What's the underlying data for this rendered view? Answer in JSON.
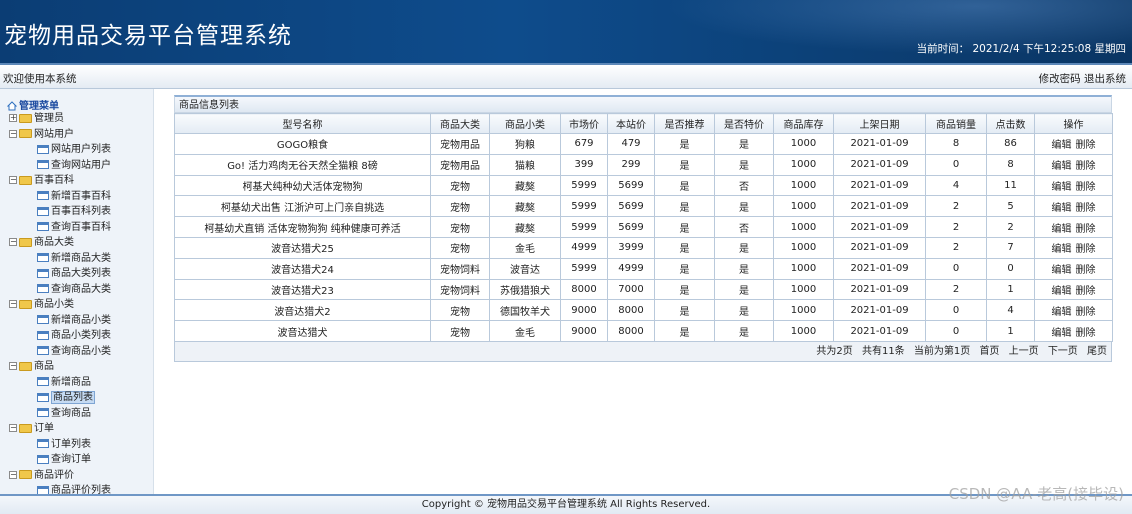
{
  "header": {
    "title": "宠物用品交易平台管理系统",
    "time_label": "当前时间：",
    "time_value": "2021/2/4 下午12:25:08 星期四"
  },
  "topbar": {
    "welcome": "欢迎使用本系统",
    "change_password": "修改密码",
    "logout": "退出系统"
  },
  "sidebar": {
    "root": "管理菜单",
    "groups": [
      {
        "label": "管理员",
        "items": []
      },
      {
        "label": "网站用户",
        "items": [
          "网站用户列表",
          "查询网站用户"
        ]
      },
      {
        "label": "百事百科",
        "items": [
          "新增百事百科",
          "百事百科列表",
          "查询百事百科"
        ]
      },
      {
        "label": "商品大类",
        "items": [
          "新增商品大类",
          "商品大类列表",
          "查询商品大类"
        ]
      },
      {
        "label": "商品小类",
        "items": [
          "新增商品小类",
          "商品小类列表",
          "查询商品小类"
        ]
      },
      {
        "label": "商品",
        "items": [
          "新增商品",
          "商品列表",
          "查询商品"
        ]
      },
      {
        "label": "订单",
        "items": [
          "订单列表",
          "查询订单"
        ]
      },
      {
        "label": "商品评价",
        "items": [
          "商品评价列表"
        ]
      }
    ],
    "selected": "商品列表"
  },
  "main": {
    "panel_title": "商品信息列表",
    "columns": [
      "型号名称",
      "商品大类",
      "商品小类",
      "市场价",
      "本站价",
      "是否推荐",
      "是否特价",
      "商品库存",
      "上架日期",
      "商品销量",
      "点击数",
      "操作"
    ],
    "edit_label": "编辑",
    "delete_label": "删除",
    "rows": [
      [
        "GOGO粮食",
        "宠物用品",
        "狗粮",
        "679",
        "479",
        "是",
        "是",
        "1000",
        "2021-01-09",
        "8",
        "86"
      ],
      [
        "Go! 活力鸡肉无谷天然全猫粮 8磅",
        "宠物用品",
        "猫粮",
        "399",
        "299",
        "是",
        "是",
        "1000",
        "2021-01-09",
        "0",
        "8"
      ],
      [
        "柯基犬纯种幼犬活体宠物狗",
        "宠物",
        "藏獒",
        "5999",
        "5699",
        "是",
        "否",
        "1000",
        "2021-01-09",
        "4",
        "11"
      ],
      [
        "柯基幼犬出售 江浙沪可上门亲自挑选",
        "宠物",
        "藏獒",
        "5999",
        "5699",
        "是",
        "是",
        "1000",
        "2021-01-09",
        "2",
        "5"
      ],
      [
        "柯基幼犬直销 活体宠物狗狗 纯种健康可养活",
        "宠物",
        "藏獒",
        "5999",
        "5699",
        "是",
        "否",
        "1000",
        "2021-01-09",
        "2",
        "2"
      ],
      [
        "波音达猎犬25",
        "宠物",
        "金毛",
        "4999",
        "3999",
        "是",
        "是",
        "1000",
        "2021-01-09",
        "2",
        "7"
      ],
      [
        "波音达猎犬24",
        "宠物饲料",
        "波音达",
        "5999",
        "4999",
        "是",
        "是",
        "1000",
        "2021-01-09",
        "0",
        "0"
      ],
      [
        "波音达猎犬23",
        "宠物饲料",
        "苏俄猎狼犬",
        "8000",
        "7000",
        "是",
        "是",
        "1000",
        "2021-01-09",
        "2",
        "1"
      ],
      [
        "波音达猎犬2",
        "宠物",
        "德国牧羊犬",
        "9000",
        "8000",
        "是",
        "是",
        "1000",
        "2021-01-09",
        "0",
        "4"
      ],
      [
        "波音达猎犬",
        "宠物",
        "金毛",
        "9000",
        "8000",
        "是",
        "是",
        "1000",
        "2021-01-09",
        "0",
        "1"
      ]
    ],
    "pager": {
      "total_pages": "共为2页",
      "total_items": "共有11条",
      "current": "当前为第1页",
      "first": "首页",
      "prev": "上一页",
      "next": "下一页",
      "last": "尾页"
    }
  },
  "footer": {
    "copyright": "Copyright © 宠物用品交易平台管理系统 All Rights Reserved."
  },
  "watermark": "CSDN @AA-老高(接毕设)"
}
